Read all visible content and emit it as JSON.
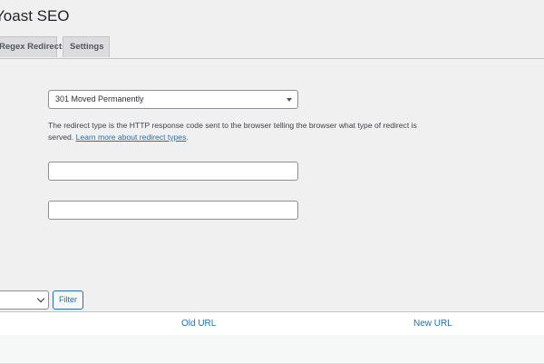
{
  "page": {
    "title": "Yoast SEO"
  },
  "tabs": [
    {
      "label": "Regex Redirects",
      "active": false
    },
    {
      "label": "Settings",
      "active": false
    }
  ],
  "form": {
    "redirect_type": {
      "value": "301 Moved Permanently"
    },
    "help_text": "The redirect type is the HTTP response code sent to the browser telling the browser what type of redirect is served.",
    "help_link": "Learn more about redirect types",
    "help_suffix": ".",
    "old_url": {
      "value": ""
    },
    "new_url": {
      "value": ""
    }
  },
  "filter": {
    "select_value": "",
    "button_label": "Filter"
  },
  "table": {
    "columns": [
      "Old URL",
      "New URL"
    ]
  },
  "colors": {
    "link": "#2271b1",
    "background": "#f0f0f1"
  }
}
